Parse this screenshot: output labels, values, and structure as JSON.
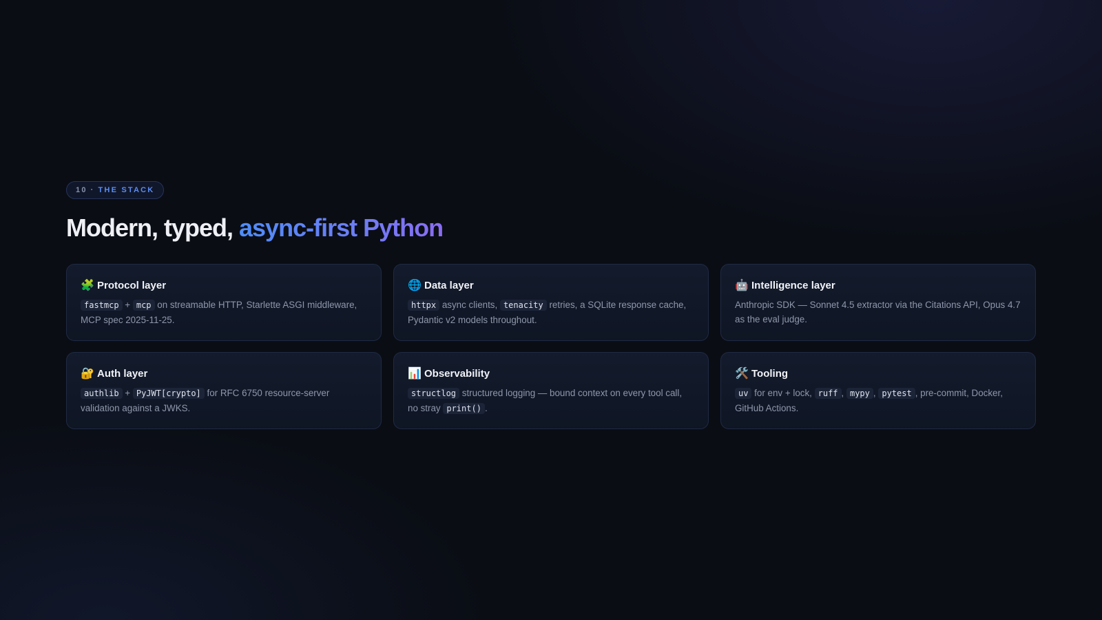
{
  "eyebrow": {
    "number": "10",
    "separator": "·",
    "label": "THE STACK"
  },
  "title": {
    "plain": "Modern, typed, ",
    "accent": "async-first Python"
  },
  "cards": [
    {
      "icon": "puzzle-icon",
      "glyph": "🧩",
      "title": "Protocol layer",
      "body": [
        {
          "code": "fastmcp"
        },
        {
          "text": " + "
        },
        {
          "code": "mcp"
        },
        {
          "text": " on streamable HTTP, Starlette ASGI middleware, MCP spec 2025-11-25."
        }
      ]
    },
    {
      "icon": "globe-icon",
      "glyph": "🌐",
      "title": "Data layer",
      "body": [
        {
          "code": "httpx"
        },
        {
          "text": " async clients, "
        },
        {
          "code": "tenacity"
        },
        {
          "text": " retries, a SQLite response cache, Pydantic v2 models throughout."
        }
      ]
    },
    {
      "icon": "robot-icon",
      "glyph": "🤖",
      "title": "Intelligence layer",
      "body": [
        {
          "text": "Anthropic SDK — Sonnet 4.5 extractor via the Citations API, Opus 4.7 as the eval judge."
        }
      ]
    },
    {
      "icon": "lock-key-icon",
      "glyph": "🔐",
      "title": "Auth layer",
      "body": [
        {
          "code": "authlib"
        },
        {
          "text": " + "
        },
        {
          "code": "PyJWT[crypto]"
        },
        {
          "text": " for RFC 6750 resource-server validation against a JWKS."
        }
      ]
    },
    {
      "icon": "bar-chart-icon",
      "glyph": "📊",
      "title": "Observability",
      "body": [
        {
          "code": "structlog"
        },
        {
          "text": " structured logging — bound context on every tool call, no stray "
        },
        {
          "code": "print()"
        },
        {
          "text": "."
        }
      ]
    },
    {
      "icon": "tools-icon",
      "glyph": "🛠️",
      "title": "Tooling",
      "body": [
        {
          "code": "uv"
        },
        {
          "text": " for env + lock, "
        },
        {
          "code": "ruff"
        },
        {
          "text": ", "
        },
        {
          "code": "mypy"
        },
        {
          "text": ", "
        },
        {
          "code": "pytest"
        },
        {
          "text": ", pre-commit, Docker, GitHub Actions."
        }
      ]
    }
  ]
}
